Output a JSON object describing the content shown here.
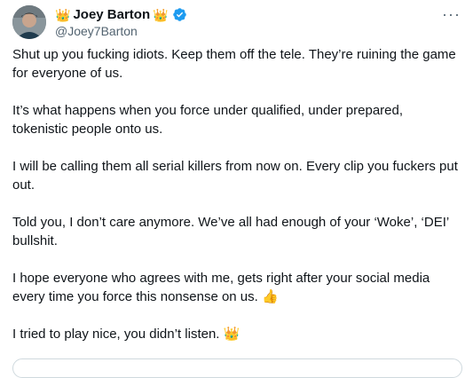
{
  "tweet": {
    "display_name": "Joey Barton",
    "name_emoji_left": "👑",
    "name_emoji_right": "👑",
    "handle": "@Joey7Barton",
    "more_label": "···",
    "paragraphs": [
      "Shut up you fucking idiots. Keep them off the tele. They’re ruining the game for everyone of us.",
      "It’s what happens when you force under qualified, under prepared, tokenistic people onto us.",
      "I will be calling them all serial killers from now on. Every clip you fuckers put out.",
      "Told you, I don’t care anymore. We’ve all had enough of your ‘Woke’, ‘DEI’ bullshit.",
      "I hope everyone who agrees with me, gets right after your social media every time you force this nonsense on us. 👍",
      "I tried to play nice, you didn’t listen. 👑"
    ]
  },
  "colors": {
    "text": "#0f1419",
    "secondary": "#536471",
    "verified": "#1d9bf0"
  },
  "icons": {
    "verified": "verified-badge-icon",
    "more": "more-horizontal-icon"
  }
}
